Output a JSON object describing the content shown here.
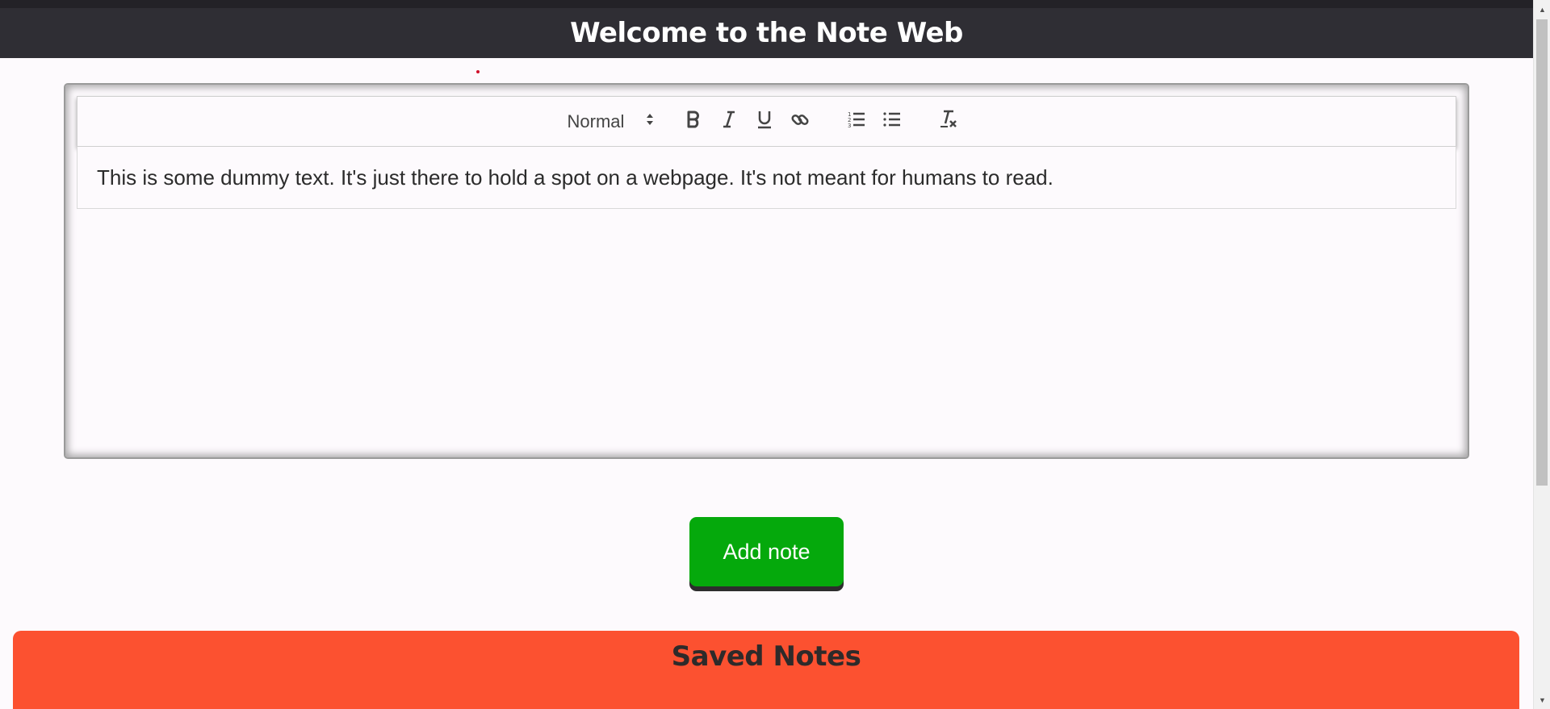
{
  "header": {
    "title": "Welcome to the Note Web"
  },
  "editor": {
    "toolbar": {
      "format_select": "Normal",
      "buttons": [
        "bold",
        "italic",
        "underline",
        "link",
        "ordered-list",
        "bullet-list",
        "clean-formatting"
      ]
    },
    "content": "This is some dummy text. It's just there to hold a spot on a webpage. It's not meant for humans to read."
  },
  "actions": {
    "add_note_label": "Add note"
  },
  "saved_notes": {
    "title": "Saved Notes"
  },
  "colors": {
    "header_bg": "#2f2e34",
    "add_button": "#05a90c",
    "saved_notes_bg": "#fc5130"
  },
  "icons": {
    "select_arrows": "up-down-arrows-icon",
    "bold": "bold-icon",
    "italic": "italic-icon",
    "underline": "underline-icon",
    "link": "link-icon",
    "ordered_list": "ordered-list-icon",
    "bullet_list": "bullet-list-icon",
    "clean": "clear-format-icon"
  }
}
